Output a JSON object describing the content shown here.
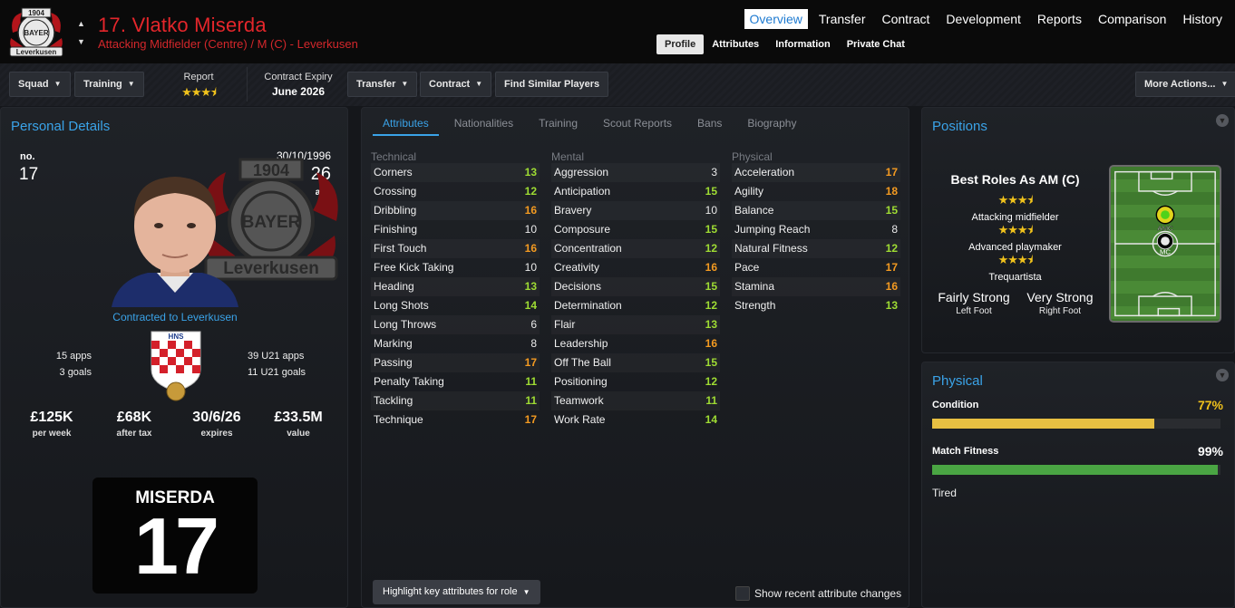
{
  "header": {
    "club_badge_text": {
      "top": "1904",
      "middle": "BAYER",
      "bottom": "Leverkusen"
    },
    "title": "17. Vlatko Miserda",
    "subtitle": "Attacking Midfielder (Centre) / M (C) - Leverkusen",
    "nav_up": "▲",
    "nav_down": "▼",
    "main_tabs": [
      "Overview",
      "Transfer",
      "Contract",
      "Development",
      "Reports",
      "Comparison",
      "History"
    ],
    "sub_tabs": [
      "Profile",
      "Attributes",
      "Information",
      "Private Chat"
    ]
  },
  "toolbar": {
    "squad": "Squad",
    "training": "Training",
    "report_label": "Report",
    "report_stars": 3.5,
    "contract_expiry_label": "Contract Expiry",
    "contract_expiry_value": "June 2026",
    "transfer": "Transfer",
    "contract": "Contract",
    "find_similar": "Find Similar Players",
    "more_actions": "More Actions...",
    "caret": "▼"
  },
  "personal": {
    "title": "Personal Details",
    "no_label": "no.",
    "number": "17",
    "dob": "30/10/1996",
    "age": "26",
    "age_label": "age",
    "contracted_to": "Contracted to Leverkusen",
    "flag_text": "HNS",
    "apps": "15 apps",
    "goals": "3 goals",
    "u21_apps": "39 U21 apps",
    "u21_goals": "11 U21 goals",
    "money": [
      {
        "value": "£125K",
        "label": "per week"
      },
      {
        "value": "£68K",
        "label": "after tax"
      },
      {
        "value": "30/6/26",
        "label": "expires"
      },
      {
        "value": "£33.5M",
        "label": "value"
      }
    ],
    "shirt_name": "MISERDA",
    "shirt_number": "17"
  },
  "attributes": {
    "tabs": [
      "Attributes",
      "Nationalities",
      "Training",
      "Scout Reports",
      "Bans",
      "Biography"
    ],
    "technical_label": "Technical",
    "mental_label": "Mental",
    "physical_label": "Physical",
    "technical": [
      {
        "name": "Corners",
        "value": 13
      },
      {
        "name": "Crossing",
        "value": 12
      },
      {
        "name": "Dribbling",
        "value": 16
      },
      {
        "name": "Finishing",
        "value": 10
      },
      {
        "name": "First Touch",
        "value": 16
      },
      {
        "name": "Free Kick Taking",
        "value": 10
      },
      {
        "name": "Heading",
        "value": 13
      },
      {
        "name": "Long Shots",
        "value": 14
      },
      {
        "name": "Long Throws",
        "value": 6
      },
      {
        "name": "Marking",
        "value": 8
      },
      {
        "name": "Passing",
        "value": 17
      },
      {
        "name": "Penalty Taking",
        "value": 11
      },
      {
        "name": "Tackling",
        "value": 11
      },
      {
        "name": "Technique",
        "value": 17
      }
    ],
    "mental": [
      {
        "name": "Aggression",
        "value": 3
      },
      {
        "name": "Anticipation",
        "value": 15
      },
      {
        "name": "Bravery",
        "value": 10
      },
      {
        "name": "Composure",
        "value": 15
      },
      {
        "name": "Concentration",
        "value": 12
      },
      {
        "name": "Creativity",
        "value": 16
      },
      {
        "name": "Decisions",
        "value": 15
      },
      {
        "name": "Determination",
        "value": 12
      },
      {
        "name": "Flair",
        "value": 13
      },
      {
        "name": "Leadership",
        "value": 16
      },
      {
        "name": "Off The Ball",
        "value": 15
      },
      {
        "name": "Positioning",
        "value": 12
      },
      {
        "name": "Teamwork",
        "value": 11
      },
      {
        "name": "Work Rate",
        "value": 14
      }
    ],
    "physical": [
      {
        "name": "Acceleration",
        "value": 17
      },
      {
        "name": "Agility",
        "value": 18
      },
      {
        "name": "Balance",
        "value": 15
      },
      {
        "name": "Jumping Reach",
        "value": 8
      },
      {
        "name": "Natural Fitness",
        "value": 12
      },
      {
        "name": "Pace",
        "value": 17
      },
      {
        "name": "Stamina",
        "value": 16
      },
      {
        "name": "Strength",
        "value": 13
      }
    ],
    "highlight_button": "Highlight key attributes for role",
    "show_changes": "Show recent attribute changes",
    "colors": {
      "low": "#eaeaea",
      "mid": "#9fdc33",
      "high": "#f39a21"
    }
  },
  "positions": {
    "title": "Positions",
    "best_roles_title": "Best Roles As AM (C)",
    "roles": [
      {
        "name": "Attacking midfielder",
        "stars": 3.5
      },
      {
        "name": "Advanced playmaker",
        "stars": 3.5
      },
      {
        "name": "Trequartista",
        "stars": 3.5
      }
    ],
    "left_foot_value": "Fairly Strong",
    "left_foot_label": "Left Foot",
    "right_foot_value": "Very Strong",
    "right_foot_label": "Right Foot",
    "pitch_positions": [
      "AMC",
      "MC"
    ]
  },
  "physical": {
    "title": "Physical",
    "condition_label": "Condition",
    "condition_value": "77%",
    "condition_level": 0.77,
    "match_fitness_label": "Match Fitness",
    "match_fitness_value": "99%",
    "match_fitness_level": 0.99,
    "status": "Tired",
    "condition_color": "#e8c042",
    "fitness_color": "#4aa543",
    "value_color_condition": "#f0c21c",
    "value_color_fitness": "#ffffff"
  }
}
